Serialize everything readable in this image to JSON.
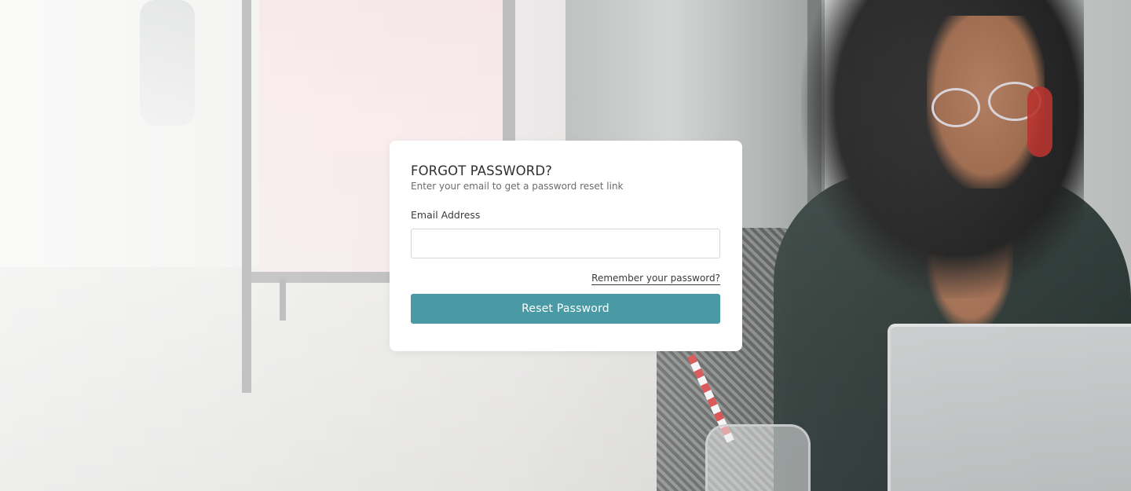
{
  "card": {
    "title": "FORGOT PASSWORD?",
    "subtitle": "Enter your email to get a password reset link",
    "email_label": "Email Address",
    "email_value": "",
    "email_placeholder": "",
    "remember_link": "Remember your password?",
    "reset_button": "Reset Password"
  },
  "colors": {
    "accent": "#4a9aa5",
    "card_background": "#ffffff",
    "title_text": "#2f2f2f"
  }
}
